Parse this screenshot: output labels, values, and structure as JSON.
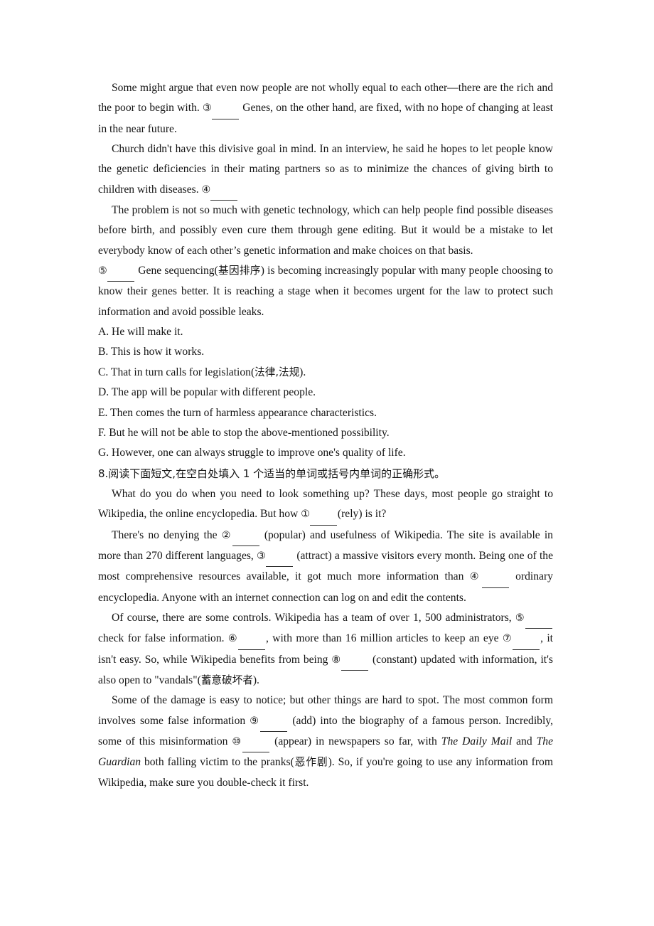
{
  "document": {
    "blocks": [
      {
        "kind": "paragraph",
        "name": "paragraph-equality",
        "segments": [
          {
            "t": "text",
            "v": "Some might argue that even now people are not wholly equal to each other—there are the rich and the poor to begin with. "
          },
          {
            "t": "circled",
            "v": "③"
          },
          {
            "t": "blank",
            "v": "w5"
          },
          {
            "t": "text",
            "v": " Genes, on the other hand, are fixed, with no hope of changing at least in the near future."
          }
        ]
      },
      {
        "kind": "paragraph",
        "name": "paragraph-church",
        "segments": [
          {
            "t": "text",
            "v": "Church didn't have this divisive goal in mind. In an interview, he said he hopes to let people know the genetic deficiencies in their mating partners so as to minimize the chances of giving birth to children with diseases. "
          },
          {
            "t": "circled",
            "v": "④"
          },
          {
            "t": "blank",
            "v": "w5"
          }
        ]
      },
      {
        "kind": "paragraph",
        "name": "paragraph-problem",
        "segments": [
          {
            "t": "text",
            "v": "The problem is not so much with genetic technology, which can help people find possible diseases before birth, and possibly even cure them through gene editing. But it would be a mistake to let everybody know of each other’s genetic information and make choices on that basis."
          }
        ]
      },
      {
        "kind": "paragraph",
        "name": "paragraph-gene-sequencing",
        "segments": [
          {
            "t": "circled",
            "v": "⑤"
          },
          {
            "t": "blank",
            "v": "w5"
          },
          {
            "t": "text",
            "v": " Gene sequencing("
          },
          {
            "t": "cn",
            "v": "基因排序"
          },
          {
            "t": "text",
            "v": ") is becoming increasingly popular with many people choosing to know their genes better. It is reaching a stage when it becomes urgent for the law to protect such information and avoid possible leaks."
          }
        ]
      },
      {
        "kind": "option",
        "name": "option-a",
        "segments": [
          {
            "t": "text",
            "v": "A. He will make it."
          }
        ]
      },
      {
        "kind": "option",
        "name": "option-b",
        "segments": [
          {
            "t": "text",
            "v": "B. This is how it works."
          }
        ]
      },
      {
        "kind": "option",
        "name": "option-c",
        "segments": [
          {
            "t": "text",
            "v": "C. That in turn calls for legislation("
          },
          {
            "t": "cn",
            "v": "法律,法规"
          },
          {
            "t": "text",
            "v": ")."
          }
        ]
      },
      {
        "kind": "option",
        "name": "option-d",
        "segments": [
          {
            "t": "text",
            "v": "D. The app will be popular with different people."
          }
        ]
      },
      {
        "kind": "option",
        "name": "option-e",
        "segments": [
          {
            "t": "text",
            "v": "E. Then comes the turn of harmless appearance characteristics."
          }
        ]
      },
      {
        "kind": "option",
        "name": "option-f",
        "segments": [
          {
            "t": "text",
            "v": "F. But he will not be able to stop the above-mentioned possibility."
          }
        ]
      },
      {
        "kind": "option",
        "name": "option-g",
        "segments": [
          {
            "t": "text",
            "v": "G. However, one can always struggle to improve one's quality of life."
          }
        ]
      },
      {
        "kind": "instruction",
        "name": "instruction-question-8",
        "segments": [
          {
            "t": "cn",
            "v": "8.阅读下面短文,在空白处填入 1 个适当的单词或括号内单词的正确形式。"
          }
        ]
      },
      {
        "kind": "paragraph",
        "name": "paragraph-wikipedia-intro",
        "segments": [
          {
            "t": "text",
            "v": "What do you do when you need to look something up? These days, most people go straight to Wikipedia, the online encyclopedia. But how "
          },
          {
            "t": "circled",
            "v": "①"
          },
          {
            "t": "blank",
            "v": "w5"
          },
          {
            "t": "text",
            "v": "(rely) is it?"
          }
        ]
      },
      {
        "kind": "paragraph",
        "name": "paragraph-wikipedia-popularity",
        "segments": [
          {
            "t": "text",
            "v": "There's no denying the "
          },
          {
            "t": "circled",
            "v": "②"
          },
          {
            "t": "blank",
            "v": "w5"
          },
          {
            "t": "text",
            "v": " (popular) and usefulness of Wikipedia. The site is available in more than 270 different languages, "
          },
          {
            "t": "circled",
            "v": "③"
          },
          {
            "t": "blank",
            "v": "w5"
          },
          {
            "t": "text",
            "v": " (attract) a massive visitors every month. Being one of the most comprehensive resources available, it got much more information than "
          },
          {
            "t": "circled",
            "v": "④"
          },
          {
            "t": "blank",
            "v": "w5"
          },
          {
            "t": "text",
            "v": " ordinary encyclopedia. Anyone with an internet connection can log on and edit the contents."
          }
        ]
      },
      {
        "kind": "paragraph",
        "name": "paragraph-wikipedia-controls",
        "segments": [
          {
            "t": "text",
            "v": "Of course, there are some controls. Wikipedia has a team of over 1, 500 administrators, "
          },
          {
            "t": "circled",
            "v": "⑤"
          },
          {
            "t": "blank",
            "v": "w5"
          },
          {
            "t": "text",
            "v": " check for false information. "
          },
          {
            "t": "circled",
            "v": "⑥"
          },
          {
            "t": "blank",
            "v": "w5"
          },
          {
            "t": "text",
            "v": ", with more than 16 million articles to keep an eye "
          },
          {
            "t": "circled",
            "v": "⑦"
          },
          {
            "t": "blank",
            "v": "w5"
          },
          {
            "t": "text",
            "v": ", it isn't easy. So, while Wikipedia benefits from being "
          },
          {
            "t": "circled",
            "v": "⑧"
          },
          {
            "t": "blank",
            "v": "w5"
          },
          {
            "t": "text",
            "v": " (constant) updated with information, it's also open to \"vandals\"("
          },
          {
            "t": "cn",
            "v": "蓄意破坏者"
          },
          {
            "t": "text",
            "v": ")."
          }
        ]
      },
      {
        "kind": "paragraph",
        "name": "paragraph-wikipedia-damage",
        "segments": [
          {
            "t": "text",
            "v": "Some of the damage is easy to notice; but other things are hard to spot. The most common form involves some false information "
          },
          {
            "t": "circled",
            "v": "⑨"
          },
          {
            "t": "blank",
            "v": "w5"
          },
          {
            "t": "text",
            "v": " (add) into the biography of a famous person. Incredibly, some of this misinformation "
          },
          {
            "t": "circled",
            "v": "⑩"
          },
          {
            "t": "blank",
            "v": "w5"
          },
          {
            "t": "text",
            "v": " (appear) in newspapers so far, with "
          },
          {
            "t": "italic",
            "v": "The Daily Mail"
          },
          {
            "t": "text",
            "v": " and "
          },
          {
            "t": "italic",
            "v": "The Guardian"
          },
          {
            "t": "text",
            "v": " both falling victim to the pranks("
          },
          {
            "t": "cn",
            "v": "恶作剧"
          },
          {
            "t": "text",
            "v": "). So, if you're going to use any information from Wikipedia, make sure you double-check it first."
          }
        ]
      }
    ]
  }
}
